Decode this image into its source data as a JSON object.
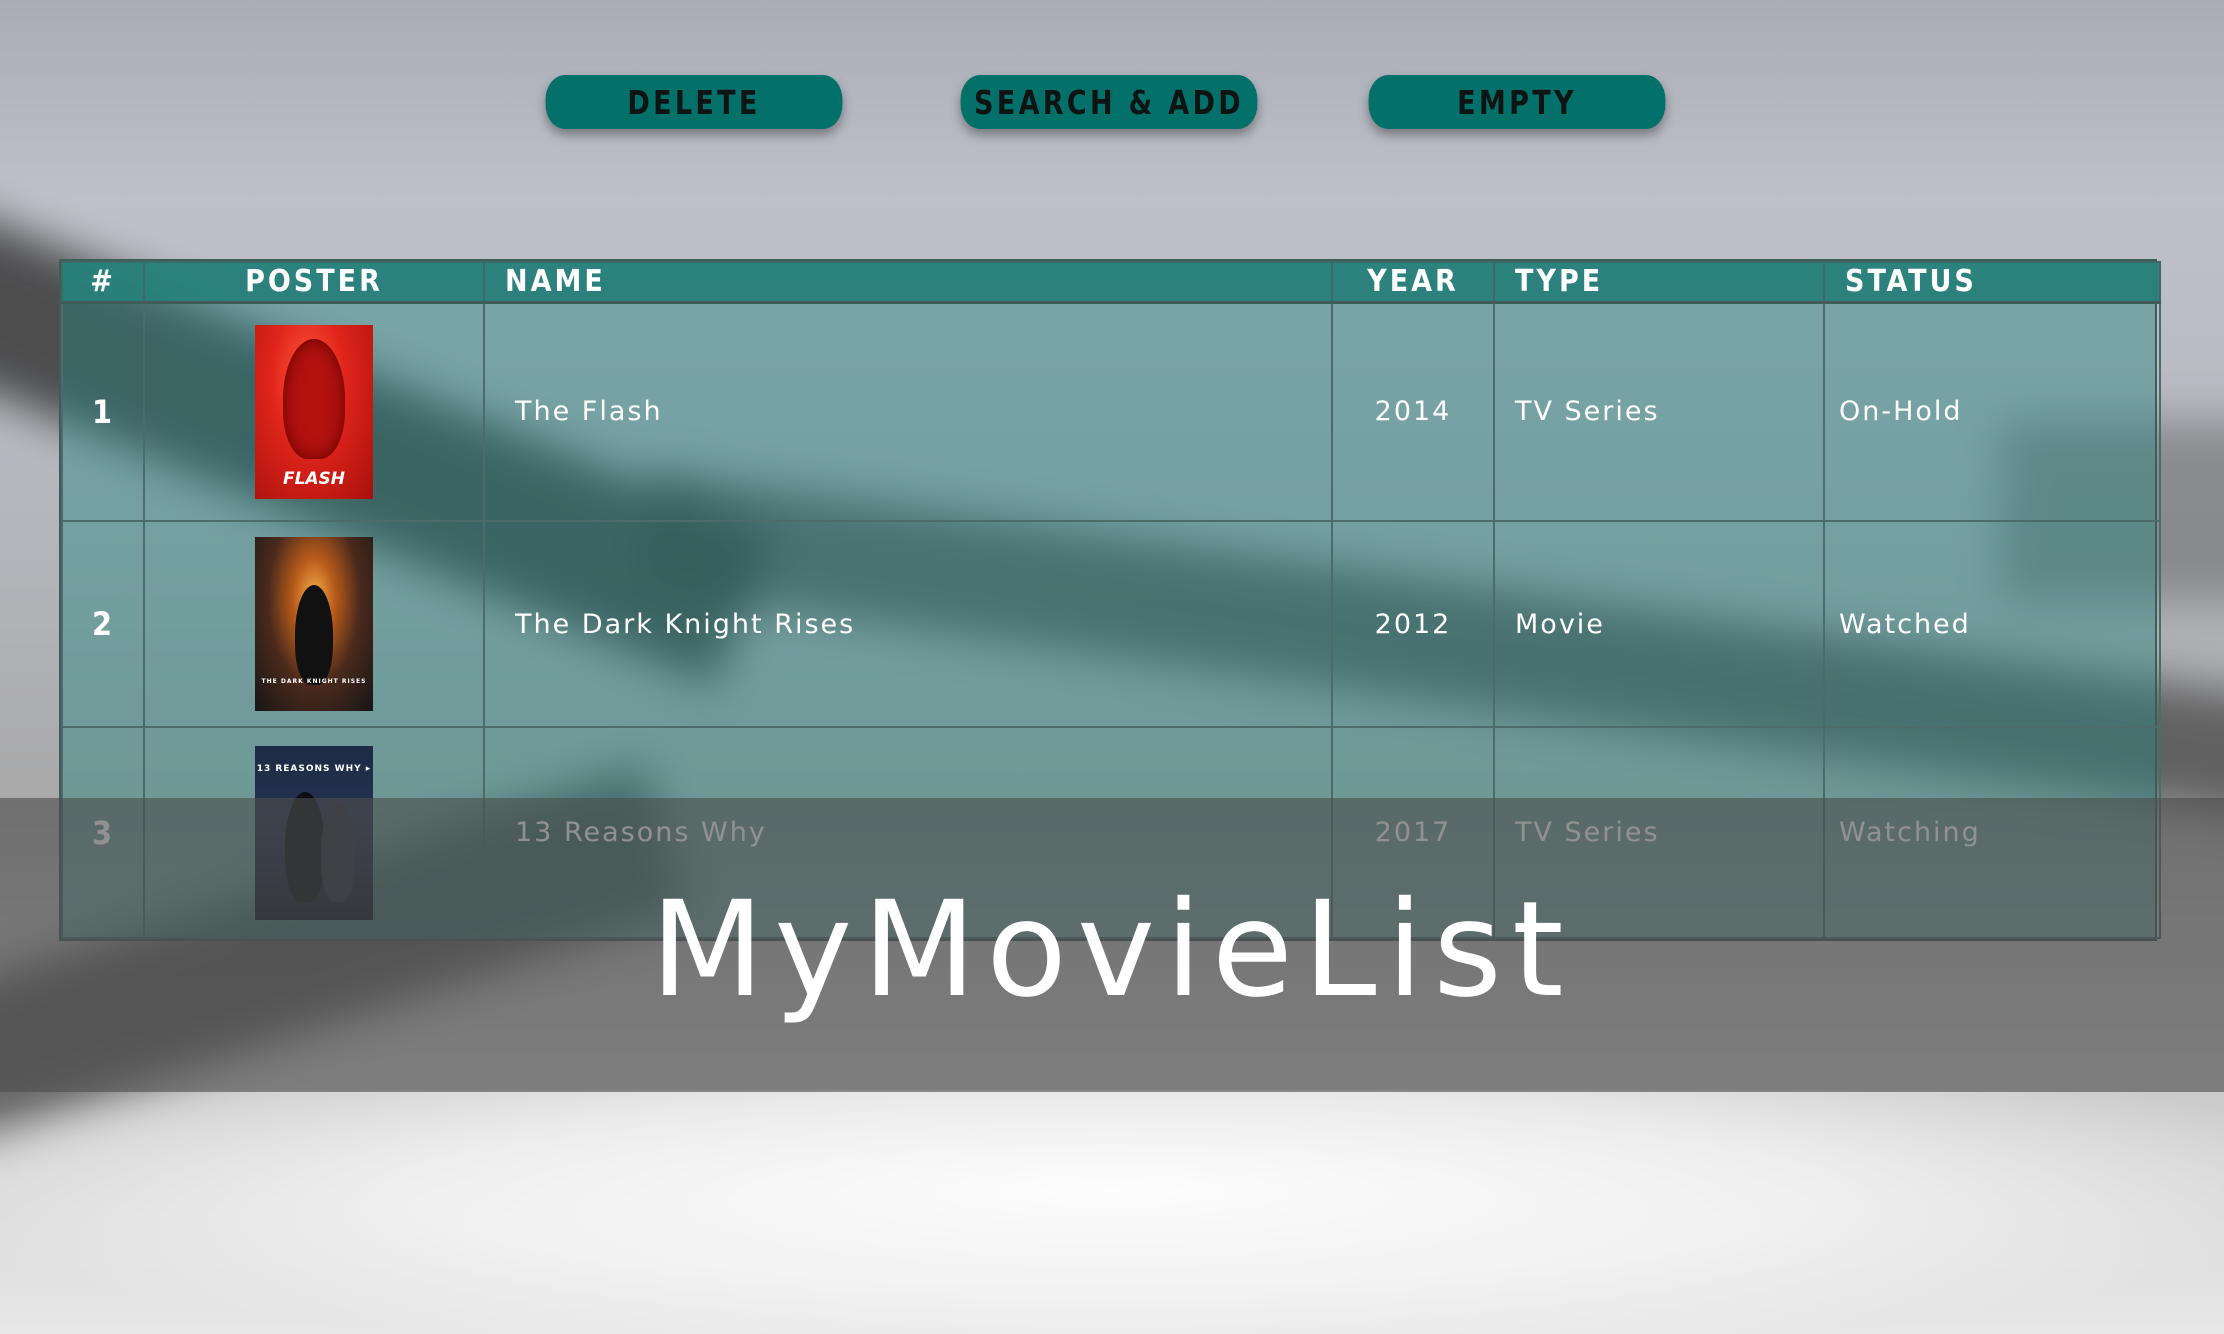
{
  "toolbar": {
    "delete_label": "DELETE",
    "search_add_label": "SEARCH & ADD",
    "empty_label": "EMPTY"
  },
  "table": {
    "columns": [
      "#",
      "POSTER",
      "NAME",
      "YEAR",
      "TYPE",
      "STATUS"
    ],
    "rows": [
      {
        "num": "1",
        "poster_title": "FLASH",
        "name": "The Flash",
        "year": "2014",
        "type": "TV Series",
        "status": "On-Hold"
      },
      {
        "num": "2",
        "poster_title": "THE DARK KNIGHT RISES",
        "name": "The Dark Knight Rises",
        "year": "2012",
        "type": "Movie",
        "status": "Watched"
      },
      {
        "num": "3",
        "poster_title": "13 REASONS WHY ▸",
        "name": "13 Reasons Why",
        "year": "2017",
        "type": "TV Series",
        "status": "Watching"
      }
    ]
  },
  "brand": {
    "title": "MyMovieList"
  },
  "colors": {
    "button": "#04706a",
    "header": "#28807a",
    "table_tint": "#288480"
  }
}
